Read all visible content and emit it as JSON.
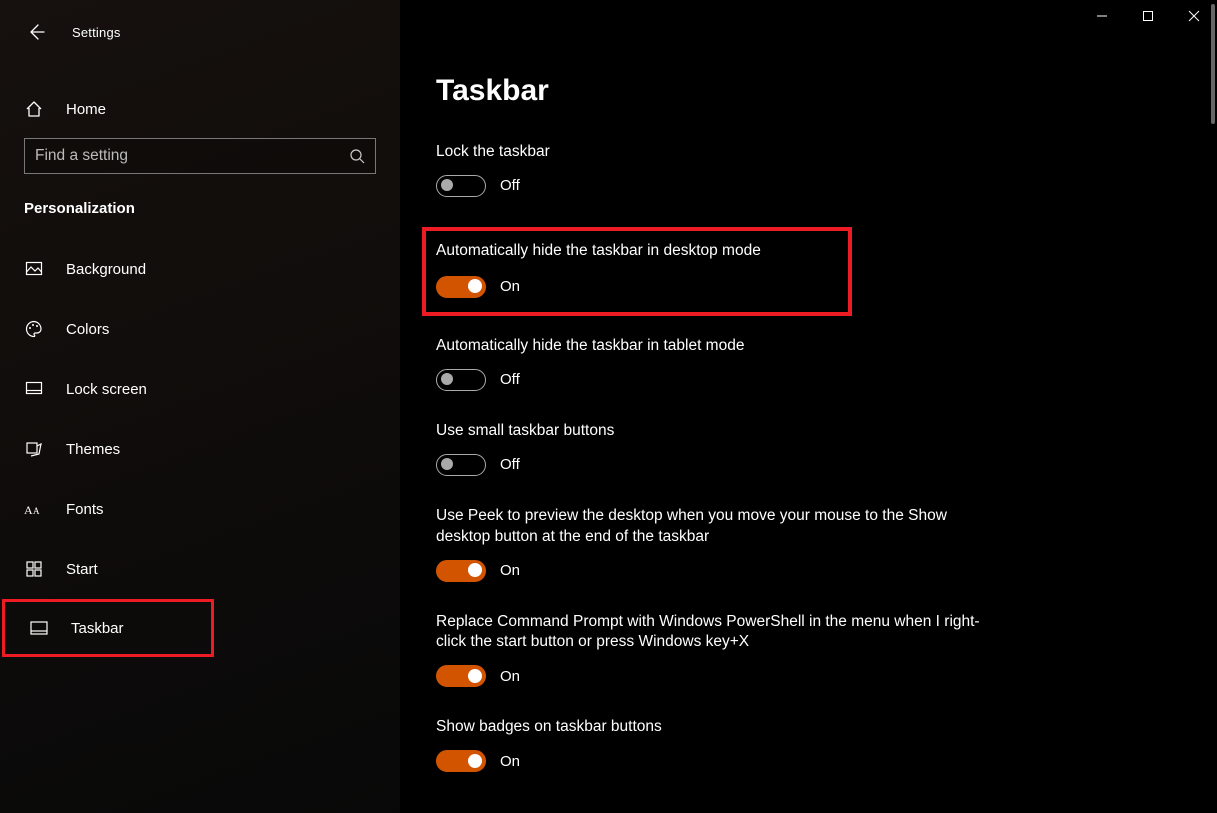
{
  "window": {
    "title": "Settings"
  },
  "sidebar": {
    "home": "Home",
    "search_placeholder": "Find a setting",
    "category": "Personalization",
    "items": [
      {
        "label": "Background"
      },
      {
        "label": "Colors"
      },
      {
        "label": "Lock screen"
      },
      {
        "label": "Themes"
      },
      {
        "label": "Fonts"
      },
      {
        "label": "Start"
      },
      {
        "label": "Taskbar"
      }
    ]
  },
  "page": {
    "title": "Taskbar",
    "settings": [
      {
        "label": "Lock the taskbar",
        "state": "Off"
      },
      {
        "label": "Automatically hide the taskbar in desktop mode",
        "state": "On"
      },
      {
        "label": "Automatically hide the taskbar in tablet mode",
        "state": "Off"
      },
      {
        "label": "Use small taskbar buttons",
        "state": "Off"
      },
      {
        "label": "Use Peek to preview the desktop when you move your mouse to the Show desktop button at the end of the taskbar",
        "state": "On"
      },
      {
        "label": "Replace Command Prompt with Windows PowerShell in the menu when I right-click the start button or press Windows key+X",
        "state": "On"
      },
      {
        "label": "Show badges on taskbar buttons",
        "state": "On"
      }
    ]
  }
}
